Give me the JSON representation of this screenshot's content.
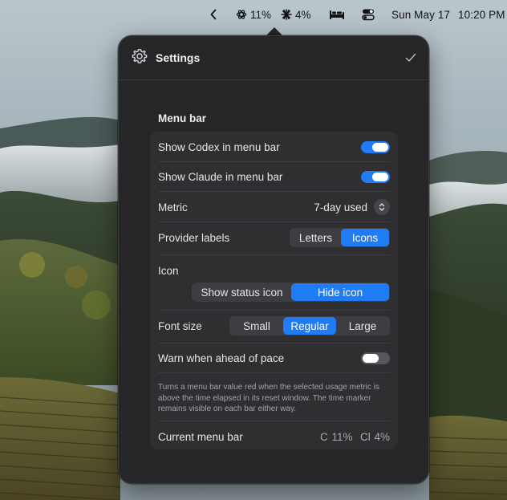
{
  "menubar": {
    "codex_percent": "11%",
    "claude_percent": "4%",
    "date": "Sun May 17",
    "time": "10:20 PM"
  },
  "popover": {
    "title": "Settings",
    "section_title": "Menu bar",
    "show_codex": {
      "label": "Show Codex in menu bar",
      "enabled": true
    },
    "show_claude": {
      "label": "Show Claude in menu bar",
      "enabled": true
    },
    "metric": {
      "label": "Metric",
      "value": "7-day used"
    },
    "provider_labels": {
      "label": "Provider labels",
      "options": [
        "Letters",
        "Icons"
      ],
      "selected": "Icons"
    },
    "icon": {
      "label": "Icon",
      "options": [
        "Show status icon",
        "Hide icon"
      ],
      "selected": "Hide icon"
    },
    "font_size": {
      "label": "Font size",
      "options": [
        "Small",
        "Regular",
        "Large"
      ],
      "selected": "Regular"
    },
    "warn_pace": {
      "label": "Warn when ahead of pace",
      "enabled": false
    },
    "help_text": "Turns a menu bar value red when the selected usage metric is above the time elapsed in its reset window. The time marker remains visible on each bar either way.",
    "current_menu_bar": {
      "label": "Current menu bar",
      "value": "C 11%  Cl 4%"
    }
  },
  "colors": {
    "accent": "#1f7cf5",
    "panel": "#262628",
    "group": "#2f2f32"
  }
}
